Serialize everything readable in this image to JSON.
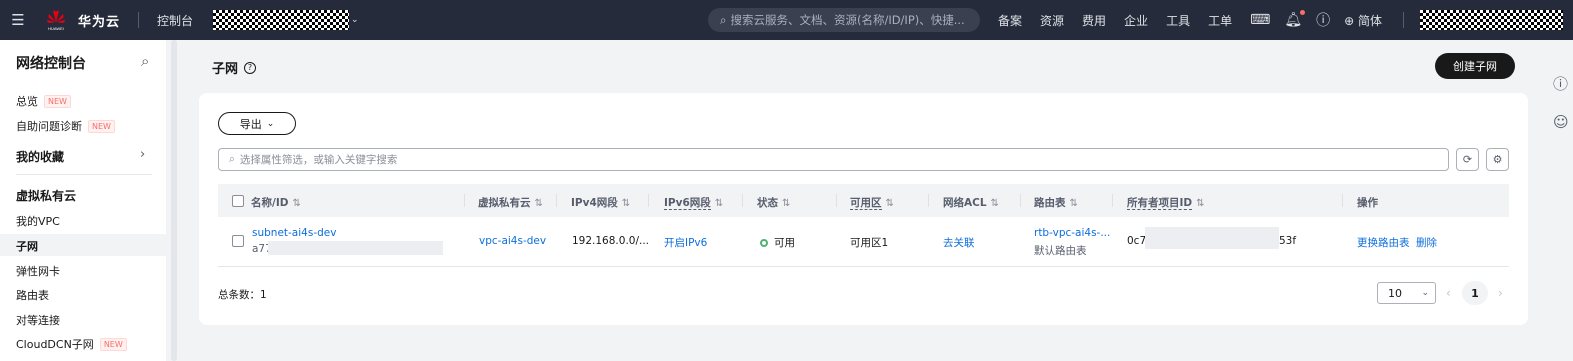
{
  "topbar": {
    "brand_sub": "HUAWEI",
    "brand": "华为云",
    "console": "控制台",
    "search_placeholder": "搜索云服务、文档、资源(名称/ID/IP)、快捷...",
    "nav": [
      "备案",
      "资源",
      "费用",
      "企业",
      "工具",
      "工单"
    ],
    "language": "简体"
  },
  "sidebar": {
    "title": "网络控制台",
    "overview": "总览",
    "new_badge": "NEW",
    "diagnosis": "自助问题诊断",
    "favorites": "我的收藏",
    "group_vpc": "虚拟私有云",
    "items": [
      "我的VPC",
      "子网",
      "弹性网卡",
      "路由表",
      "对等连接",
      "CloudDCN子网"
    ],
    "active": "子网"
  },
  "main": {
    "title": "子网",
    "help_icon": "?",
    "create_button": "创建子网",
    "export_button": "导出",
    "filter_placeholder": "选择属性筛选，或输入关键字搜索",
    "columns": [
      "名称/ID",
      "虚拟私有云",
      "IPv4网段",
      "IPv6网段",
      "状态",
      "可用区",
      "网络ACL",
      "路由表",
      "所有者项目ID",
      "操作"
    ],
    "row": {
      "name": "subnet-ai4s-dev",
      "id_prefix": "a77",
      "vpc": "vpc-ai4s-dev",
      "ipv4": "192.168.0.0/...",
      "ipv6_action": "开启IPv6",
      "status": "可用",
      "az": "可用区1",
      "acl_action": "去关联",
      "route_table": "rtb-vpc-ai4s-...",
      "route_table_type": "默认路由表",
      "owner_prefix": "0c7",
      "owner_suffix": "53f",
      "action_change_route": "更换路由表",
      "action_delete": "删除"
    },
    "total_label": "总条数：1",
    "page_size": "10",
    "current_page": "1"
  },
  "colors": {
    "topbar_bg": "#252b3a",
    "link": "#0c6ddc",
    "status_ok": "#50b371",
    "badge": "#f66f6a"
  }
}
